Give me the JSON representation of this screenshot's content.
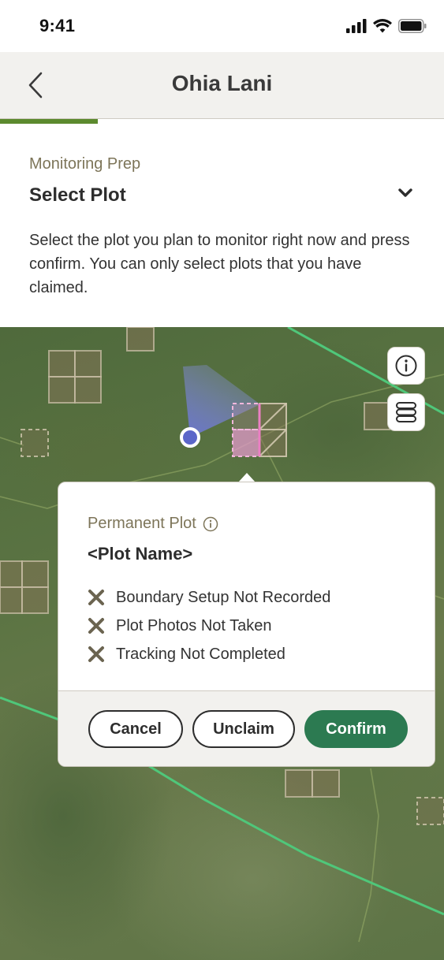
{
  "status_bar": {
    "time": "9:41"
  },
  "header": {
    "title": "Ohia Lani",
    "progress": 0.22
  },
  "prep": {
    "label": "Monitoring Prep",
    "select_title": "Select Plot",
    "instructions": "Select the plot you plan to monitor right now and press confirm. You can only select plots that you have claimed."
  },
  "map": {
    "buttons": [
      {
        "icon": "info-icon"
      },
      {
        "icon": "layers-icon"
      }
    ]
  },
  "popup": {
    "subtitle": "Permanent Plot",
    "plot_name": "<Plot Name>",
    "statuses": [
      "Boundary Setup Not Recorded",
      "Plot Photos Not Taken",
      "Tracking Not Completed"
    ],
    "buttons": {
      "cancel": "Cancel",
      "unclaim": "Unclaim",
      "confirm": "Confirm"
    }
  },
  "colors": {
    "accent_green": "#2c7a51",
    "progress_green": "#5c8a2e",
    "muted_text": "#7d7559",
    "status_x": "#6b6450",
    "boundary_line": "#4fc77a",
    "location_dot": "#5b66c9",
    "selected_plot": "#e29ac9"
  }
}
